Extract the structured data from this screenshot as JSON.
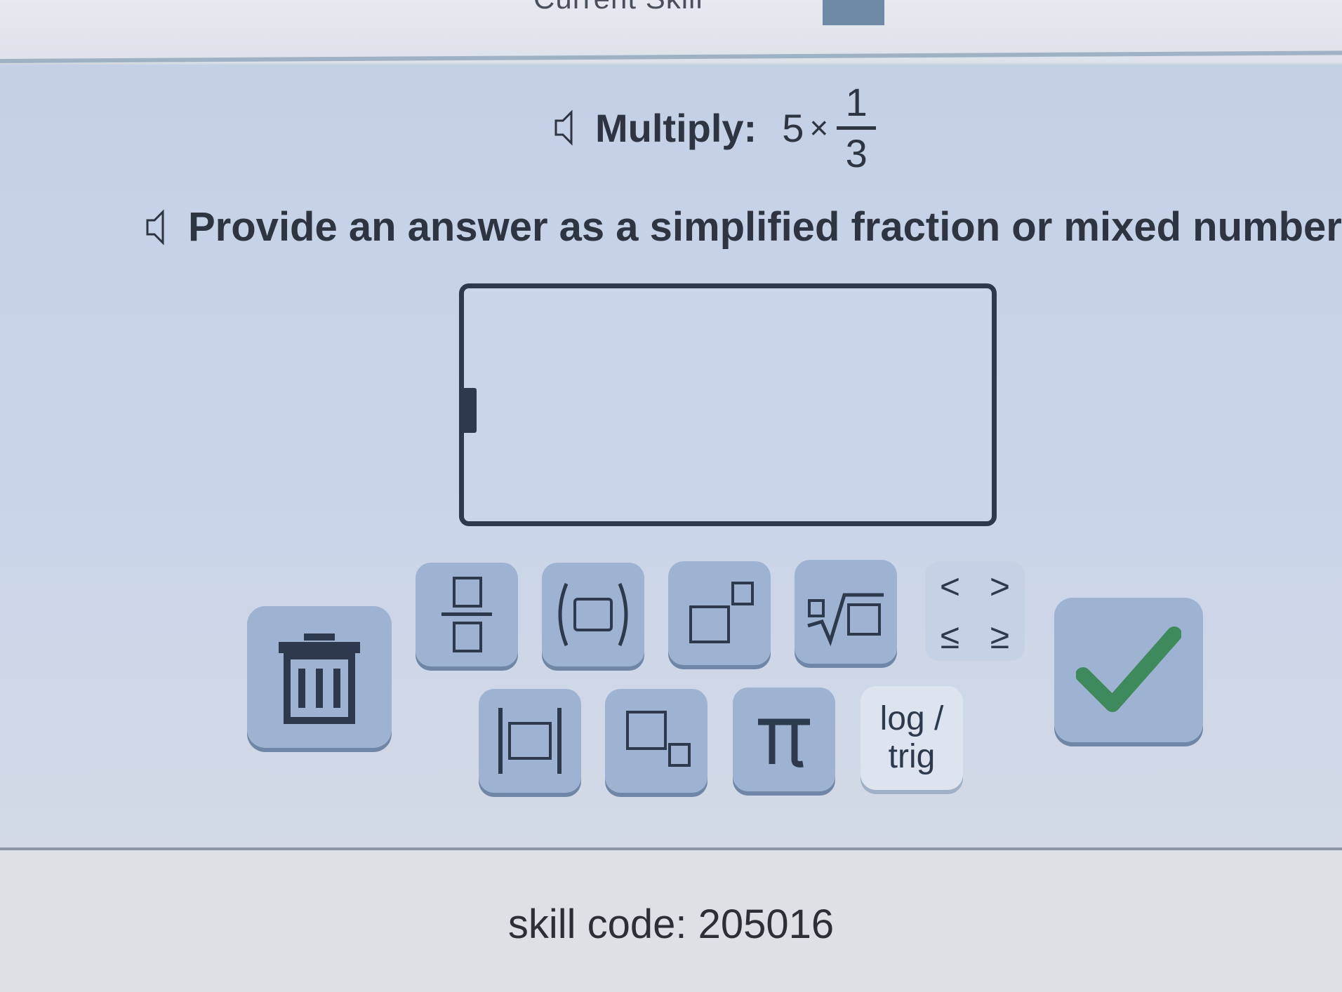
{
  "header": {
    "title": "Current Skill"
  },
  "question": {
    "prompt_label": "Multiply:",
    "whole": "5",
    "operator": "×",
    "numerator": "1",
    "denominator": "3"
  },
  "instruction": "Provide an answer as a simplified fraction or mixed number.",
  "answer": {
    "value": ""
  },
  "keypad": {
    "inequalities": [
      "<",
      ">",
      "≤",
      "≥"
    ],
    "log_label": "log /",
    "trig_label": "trig"
  },
  "footer": {
    "skill_code": "skill code: 205016"
  },
  "icons": {
    "speaker": "speaker-icon",
    "clear": "trash-icon",
    "submit": "checkmark-icon",
    "fraction": "fraction-template-icon",
    "parentheses": "parentheses-template-icon",
    "exponent": "exponent-template-icon",
    "root": "nth-root-template-icon",
    "abs": "absolute-value-template-icon",
    "subscript": "subscript-template-icon",
    "pi": "pi-icon"
  },
  "colors": {
    "check": "#3f8a5c",
    "key": "#9db3d1",
    "outline": "#2d3a4e"
  }
}
